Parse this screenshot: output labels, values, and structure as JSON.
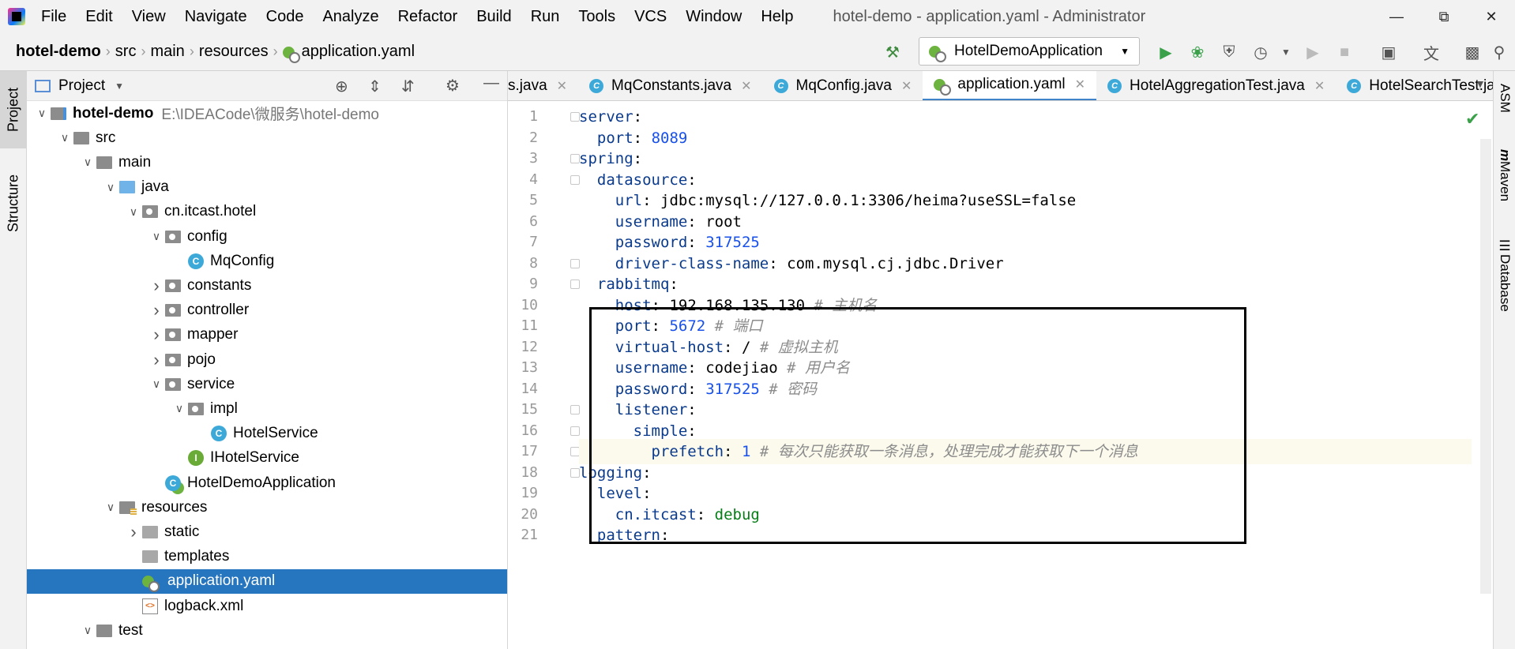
{
  "window": {
    "title": "hotel-demo - application.yaml - Administrator"
  },
  "menu": [
    {
      "label": "File"
    },
    {
      "label": "Edit"
    },
    {
      "label": "View"
    },
    {
      "label": "Navigate"
    },
    {
      "label": "Code"
    },
    {
      "label": "Analyze"
    },
    {
      "label": "Refactor"
    },
    {
      "label": "Build"
    },
    {
      "label": "Run"
    },
    {
      "label": "Tools"
    },
    {
      "label": "VCS"
    },
    {
      "label": "Window"
    },
    {
      "label": "Help"
    }
  ],
  "breadcrumb": [
    "hotel-demo",
    "src",
    "main",
    "resources",
    "application.yaml"
  ],
  "run_config": {
    "label": "HotelDemoApplication"
  },
  "left_strip": {
    "project": "Project",
    "structure": "Structure"
  },
  "right_strip": {
    "asm": "ASM",
    "maven": "Maven",
    "database": "Database"
  },
  "project_panel": {
    "title": "Project"
  },
  "tree": [
    {
      "label": "hotel-demo",
      "path": "E:\\IDEACode\\微服务\\hotel-demo",
      "bold": true
    },
    {
      "label": "src"
    },
    {
      "label": "main"
    },
    {
      "label": "java"
    },
    {
      "label": "cn.itcast.hotel"
    },
    {
      "label": "config"
    },
    {
      "label": "MqConfig"
    },
    {
      "label": "constants"
    },
    {
      "label": "controller"
    },
    {
      "label": "mapper"
    },
    {
      "label": "pojo"
    },
    {
      "label": "service"
    },
    {
      "label": "impl"
    },
    {
      "label": "HotelService"
    },
    {
      "label": "IHotelService"
    },
    {
      "label": "HotelDemoApplication"
    },
    {
      "label": "resources"
    },
    {
      "label": "static"
    },
    {
      "label": "templates"
    },
    {
      "label": "application.yaml"
    },
    {
      "label": "logback.xml"
    },
    {
      "label": "test"
    }
  ],
  "tabs": [
    {
      "label": "s.java"
    },
    {
      "label": "MqConstants.java"
    },
    {
      "label": "MqConfig.java"
    },
    {
      "label": "application.yaml",
      "active": true
    },
    {
      "label": "HotelAggregationTest.java"
    },
    {
      "label": "HotelSearchTest.ja"
    }
  ],
  "code_lines": [
    {
      "num": "1",
      "key": "server",
      "indent": "",
      "val": "",
      "comment": ""
    },
    {
      "num": "2",
      "key": "port",
      "indent": "  ",
      "val": "8089",
      "comment": ""
    },
    {
      "num": "3",
      "key": "spring",
      "indent": "",
      "val": "",
      "comment": ""
    },
    {
      "num": "4",
      "key": "datasource",
      "indent": "  ",
      "val": "",
      "comment": ""
    },
    {
      "num": "5",
      "key": "url",
      "indent": "    ",
      "val": "jdbc:mysql://127.0.0.1:3306/heima?useSSL=false",
      "comment": ""
    },
    {
      "num": "6",
      "key": "username",
      "indent": "    ",
      "val": "root",
      "comment": ""
    },
    {
      "num": "7",
      "key": "password",
      "indent": "    ",
      "val": "317525",
      "comment": ""
    },
    {
      "num": "8",
      "key": "driver-class-name",
      "indent": "    ",
      "val": "com.mysql.cj.jdbc.Driver",
      "comment": ""
    },
    {
      "num": "9",
      "key": "rabbitmq",
      "indent": "  ",
      "val": "",
      "comment": ""
    },
    {
      "num": "10",
      "key": "host",
      "indent": "    ",
      "val": "192.168.135.130",
      "comment": "# 主机名"
    },
    {
      "num": "11",
      "key": "port",
      "indent": "    ",
      "val": "5672",
      "comment": "# 端口"
    },
    {
      "num": "12",
      "key": "virtual-host",
      "indent": "    ",
      "val": "/",
      "comment": "# 虚拟主机"
    },
    {
      "num": "13",
      "key": "username",
      "indent": "    ",
      "val": "codejiao",
      "comment": "# 用户名"
    },
    {
      "num": "14",
      "key": "password",
      "indent": "    ",
      "val": "317525",
      "comment": "# 密码"
    },
    {
      "num": "15",
      "key": "listener",
      "indent": "    ",
      "val": "",
      "comment": ""
    },
    {
      "num": "16",
      "key": "simple",
      "indent": "      ",
      "val": "",
      "comment": ""
    },
    {
      "num": "17",
      "key": "prefetch",
      "indent": "        ",
      "val": "1",
      "comment": "# 每次只能获取一条消息，处理完成才能获取下一个消息"
    },
    {
      "num": "18",
      "key": "logging",
      "indent": "",
      "val": "",
      "comment": ""
    },
    {
      "num": "19",
      "key": "level",
      "indent": "  ",
      "val": "",
      "comment": ""
    },
    {
      "num": "20",
      "key": "cn.itcast",
      "indent": "    ",
      "val": "debug",
      "comment": ""
    },
    {
      "num": "21",
      "key": "pattern",
      "indent": "  ",
      "val": "",
      "comment": ""
    }
  ]
}
